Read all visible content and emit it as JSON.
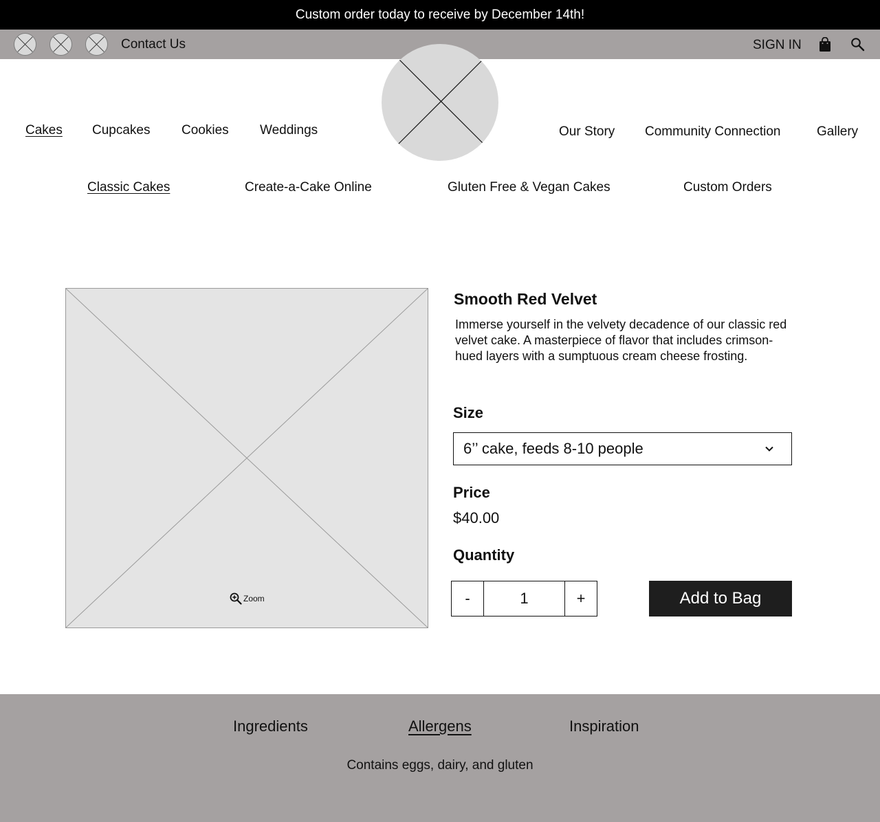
{
  "announcement": "Custom order today to receive by December 14th!",
  "topbar": {
    "social_icons": [
      "placeholder-icon",
      "placeholder-icon",
      "placeholder-icon"
    ],
    "contact_label": "Contact Us",
    "signin_label": "SIGN IN",
    "bag_icon": "shopping-bag-icon",
    "search_icon": "search-icon"
  },
  "nav": {
    "left": [
      {
        "label": "Cakes",
        "active": true
      },
      {
        "label": "Cupcakes",
        "active": false
      },
      {
        "label": "Cookies",
        "active": false
      },
      {
        "label": "Weddings",
        "active": false
      }
    ],
    "right": [
      {
        "label": "Our Story"
      },
      {
        "label": "Community Connection"
      },
      {
        "label": "Gallery"
      }
    ]
  },
  "subnav": [
    {
      "label": "Classic Cakes",
      "active": true
    },
    {
      "label": "Create-a-Cake Online",
      "active": false
    },
    {
      "label": "Gluten Free & Vegan Cakes",
      "active": false
    },
    {
      "label": "Custom Orders",
      "active": false
    }
  ],
  "product": {
    "title": "Smooth Red Velvet",
    "description": "Immerse yourself in the velvety decadence of our classic red velvet cake.  A masterpiece of flavor that includes crimson-hued layers with a sumptuous cream cheese frosting.",
    "zoom_label": "Zoom",
    "size_label": "Size",
    "size_value": "6’’ cake, feeds 8-10 people",
    "price_label": "Price",
    "price": "$40.00",
    "quantity_label": "Quantity",
    "quantity": "1",
    "minus_label": "-",
    "plus_label": "+",
    "add_to_bag_label": "Add to Bag"
  },
  "footer": {
    "tabs": [
      {
        "label": "Ingredients",
        "active": false
      },
      {
        "label": "Allergens",
        "active": true
      },
      {
        "label": "Inspiration",
        "active": false
      }
    ],
    "content": "Contains eggs, dairy, and gluten"
  },
  "colors": {
    "announcement_bg": "#000000",
    "bar_gray": "#a5a1a1",
    "placeholder_gray": "#d9d9d9",
    "image_gray": "#e4e4e4",
    "button_dark": "#1e1e1e"
  }
}
